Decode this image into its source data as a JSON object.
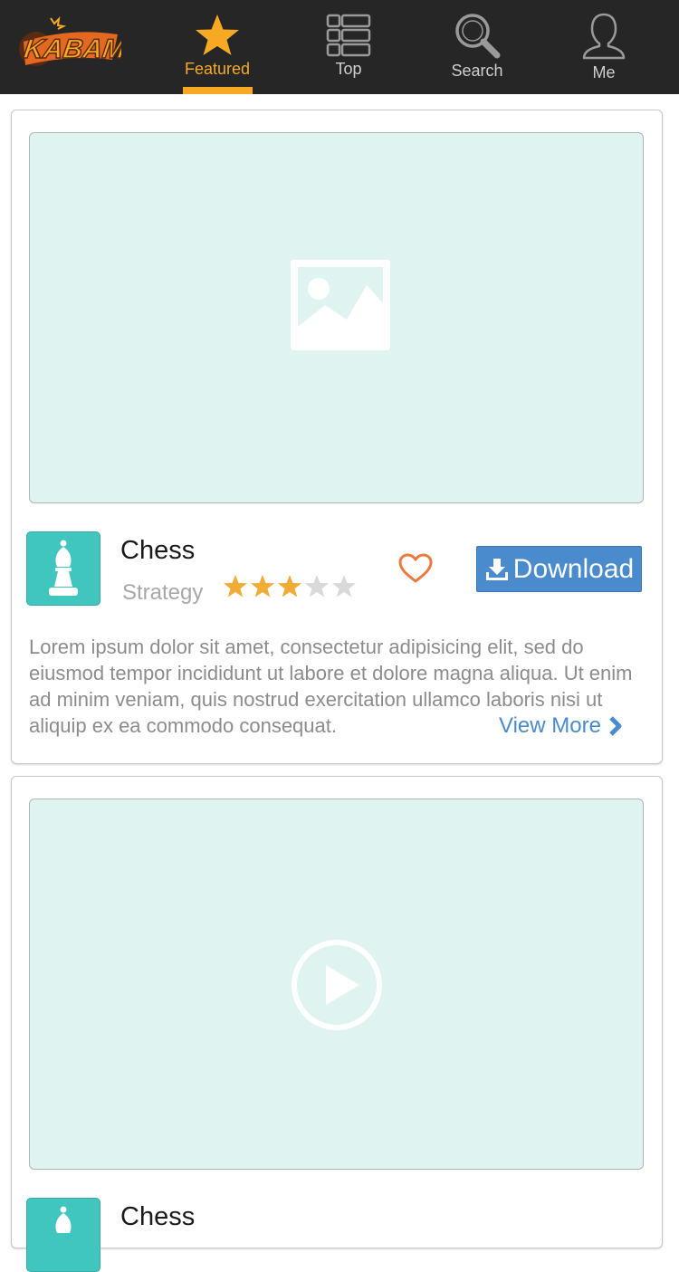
{
  "navbar": {
    "logo_text": "KABAM",
    "items": [
      {
        "label": "Featured",
        "icon": "star-icon",
        "active": true
      },
      {
        "label": "Top",
        "icon": "list-icon",
        "active": false
      },
      {
        "label": "Search",
        "icon": "search-icon",
        "active": false
      },
      {
        "label": "Me",
        "icon": "user-icon",
        "active": false
      }
    ],
    "accent_color": "#f7a924"
  },
  "cards": [
    {
      "media_type": "image-placeholder",
      "app_title": "Chess",
      "category": "Strategy",
      "rating": 3,
      "rating_max": 5,
      "download_label": "Download",
      "description": "Lorem ipsum dolor sit amet, consectetur adipisicing elit, sed do eiusmod tempor incididunt ut labore et dolore magna aliqua. Ut enim ad minim veniam, quis nostrud exercitation ullamco laboris nisi ut aliquip ex ea commodo consequat.",
      "view_more_label": "View More"
    },
    {
      "media_type": "video-placeholder",
      "app_title": "Chess"
    }
  ],
  "colors": {
    "download_button": "#4a8bcd",
    "app_icon_bg": "#41c6bf",
    "media_bg": "#dff4f1",
    "star_filled": "#f1ac36",
    "star_empty": "#d9d9d9",
    "heart": "#ec7a3e"
  }
}
